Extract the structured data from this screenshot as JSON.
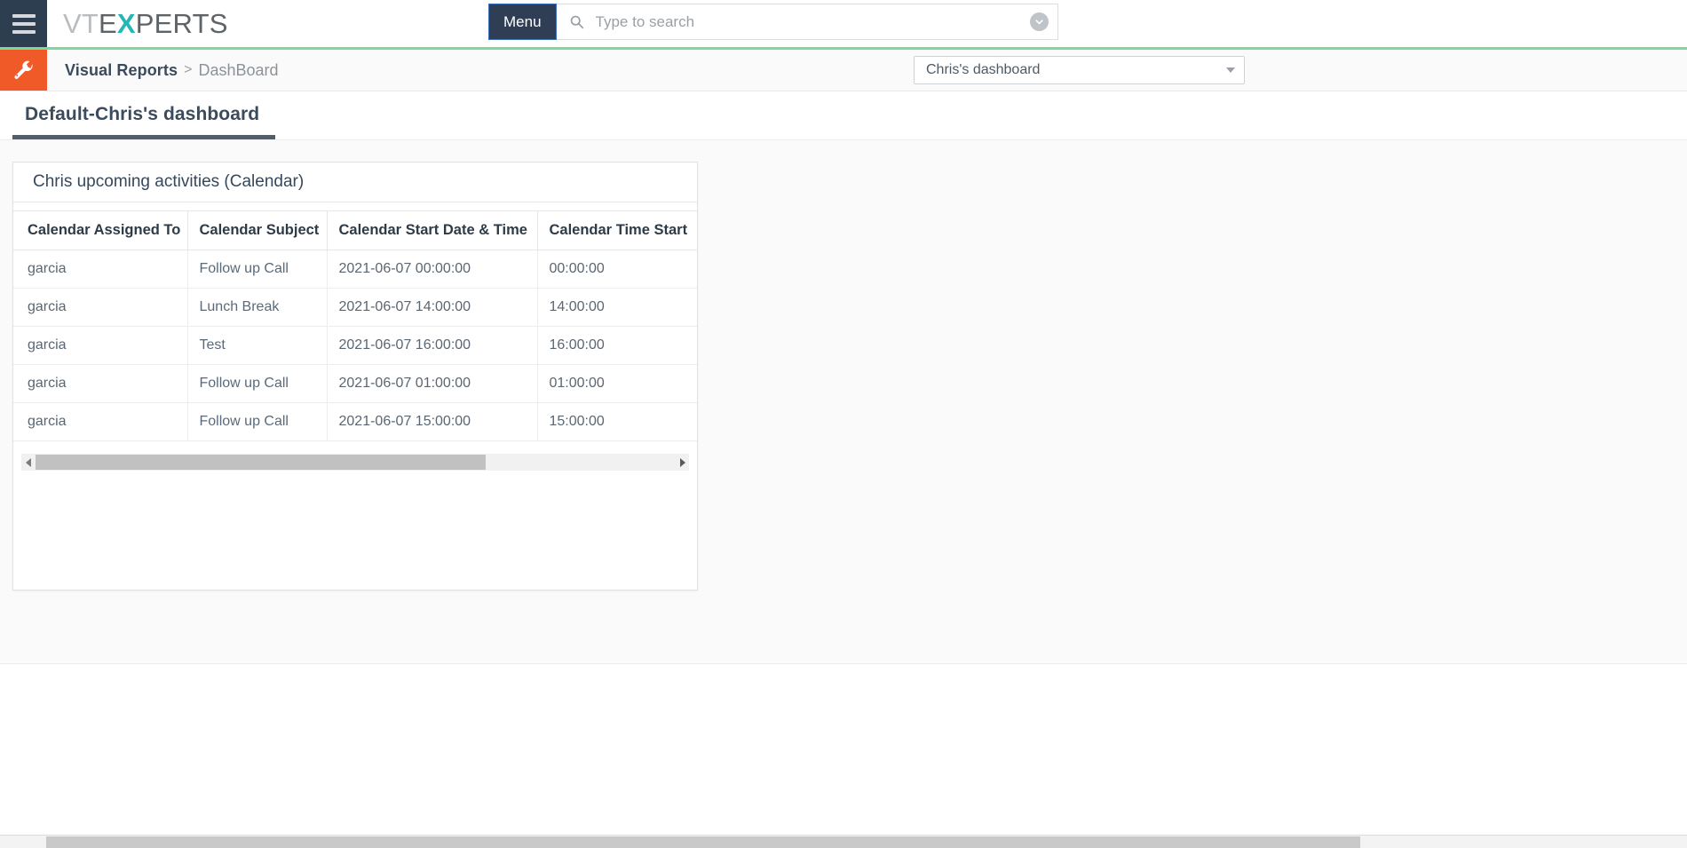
{
  "topbar": {
    "hamburger_icon": "hamburger-menu-icon",
    "brand": {
      "part_vt": "VT",
      "part_e": "E",
      "part_x": "X",
      "part_perts": "PERTS",
      "full": "VTEXPERTS"
    },
    "menu_button_label": "Menu",
    "search": {
      "icon": "search-icon",
      "placeholder": "Type to search",
      "value": "",
      "dropdown_icon": "chevron-down-circle-icon"
    },
    "accent_rule_color": "#7ed79b"
  },
  "breadcrumb_row": {
    "module_icon": "wrench-icon",
    "module_icon_bg": "#ef5a28",
    "crumb_primary": "Visual Reports",
    "crumb_separator": ">",
    "crumb_secondary": "DashBoard",
    "dashboard_select": {
      "value": "Chris's dashboard",
      "caret_icon": "caret-down-icon"
    }
  },
  "tabs": [
    {
      "label": "Default-Chris's dashboard",
      "active": true
    }
  ],
  "widget": {
    "title": "Chris upcoming activities (Calendar)",
    "table": {
      "columns": [
        "Calendar Assigned To",
        "Calendar Subject",
        "Calendar Start Date & Time",
        "Calendar Time Start"
      ],
      "rows": [
        [
          "garcia",
          "Follow up Call",
          "2021-06-07 00:00:00",
          "00:00:00"
        ],
        [
          "garcia",
          "Lunch Break",
          "2021-06-07 14:00:00",
          "14:00:00"
        ],
        [
          "garcia",
          "Test",
          "2021-06-07 16:00:00",
          "16:00:00"
        ],
        [
          "garcia",
          "Follow up Call",
          "2021-06-07 01:00:00",
          "01:00:00"
        ],
        [
          "garcia",
          "Follow up Call",
          "2021-06-07 15:00:00",
          "15:00:00"
        ]
      ]
    },
    "scrollbar": {
      "left_arrow_icon": "triangle-left-icon",
      "right_arrow_icon": "triangle-right-icon"
    }
  },
  "page_scrollbar": {
    "orientation": "horizontal"
  }
}
